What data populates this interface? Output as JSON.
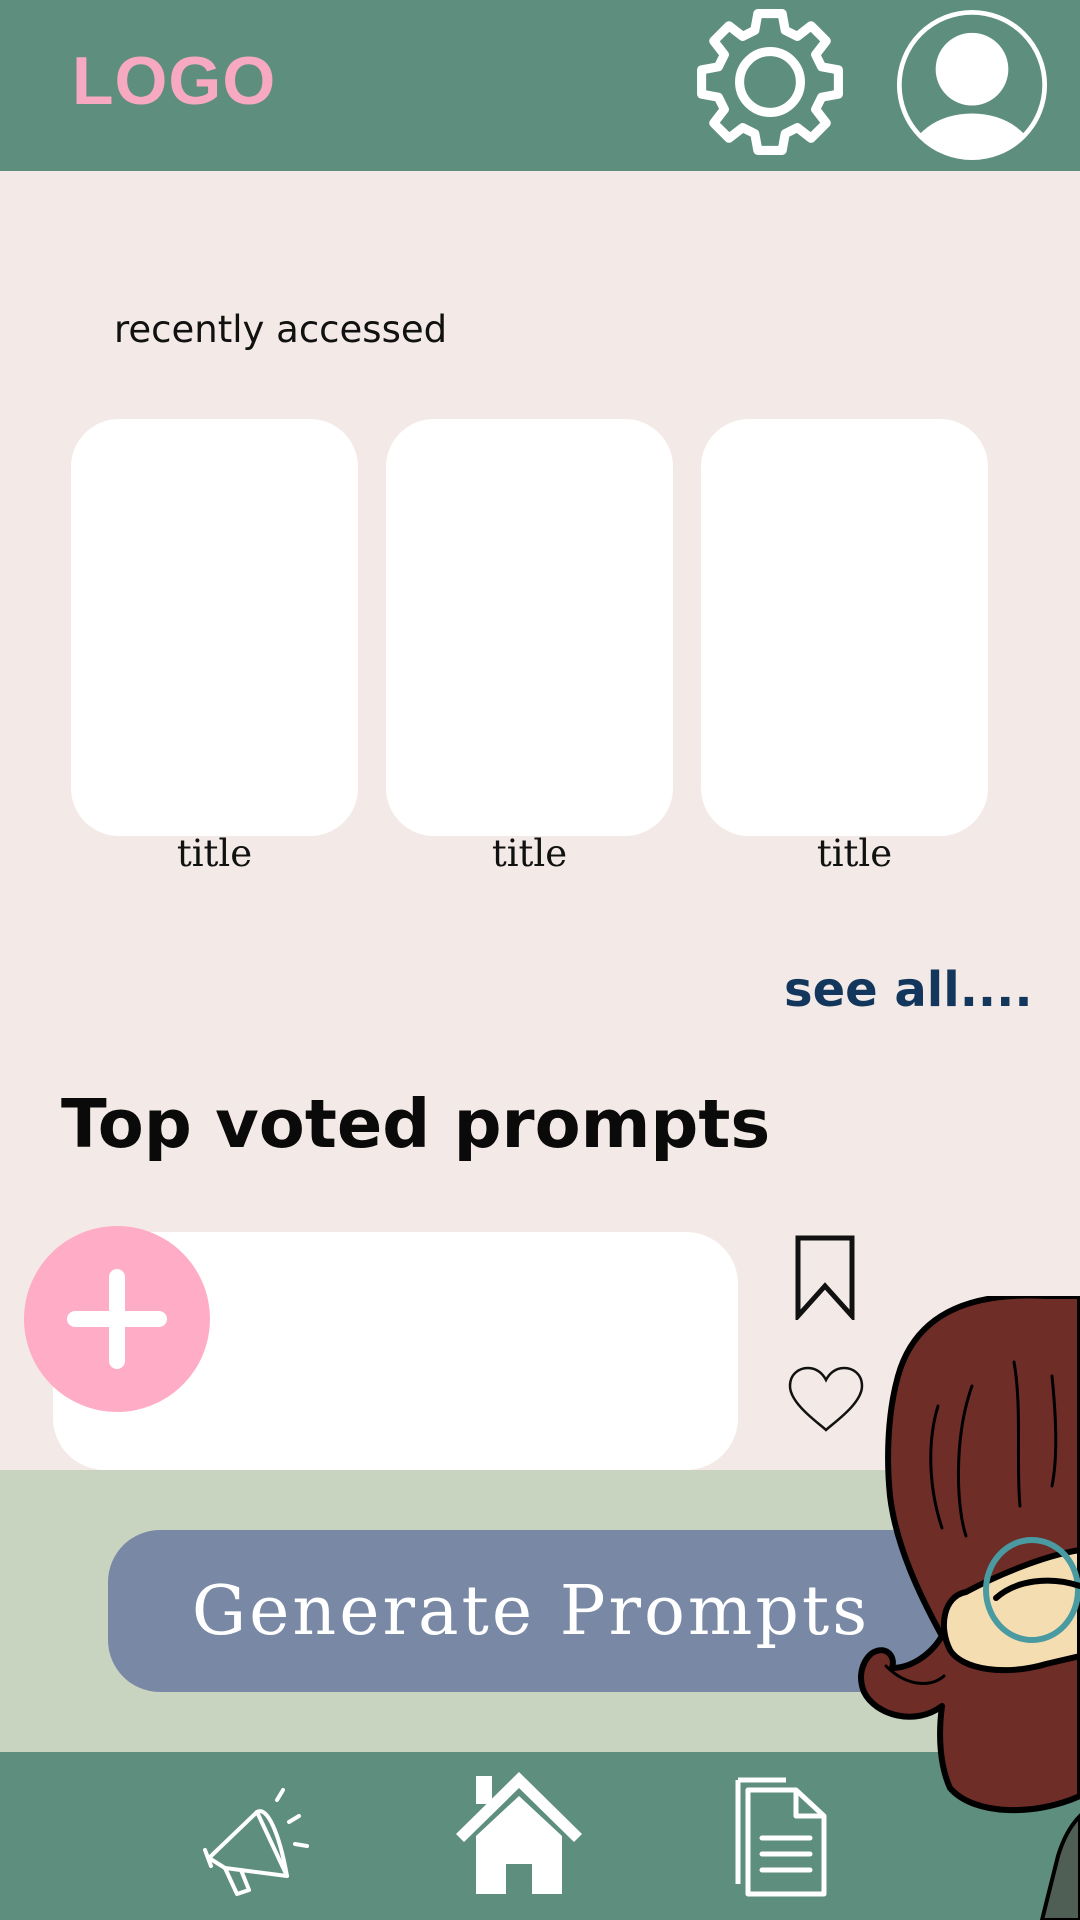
{
  "header": {
    "logo": "LOGO"
  },
  "recent": {
    "label": "recently accessed",
    "items": [
      {
        "title": "title"
      },
      {
        "title": "title"
      },
      {
        "title": "title"
      }
    ],
    "see_all": "see all...."
  },
  "top": {
    "title": "Top voted prompts"
  },
  "cta": {
    "label": "Generate Prompts"
  },
  "colors": {
    "header": "#5e8e7e",
    "logo": "#f6a9c1",
    "background": "#f3eae7",
    "accent_pink": "#ffacc6",
    "band": "#c8d4c0",
    "button": "#7988a4",
    "link": "#13375c"
  },
  "icons": {
    "header": [
      "gear-icon",
      "profile-icon"
    ],
    "prompt": [
      "plus-icon",
      "bookmark-icon",
      "heart-icon"
    ],
    "nav": [
      "megaphone-icon",
      "home-icon",
      "document-icon"
    ]
  }
}
